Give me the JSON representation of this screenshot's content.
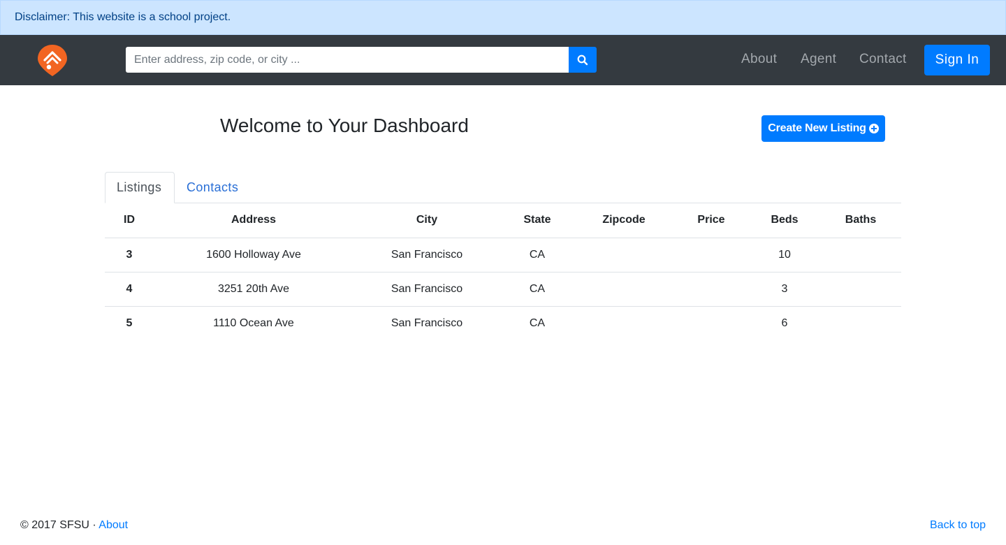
{
  "disclaimer": {
    "text": "Disclaimer: This website is a school project."
  },
  "navbar": {
    "logo_icon": "home-pin-logo-icon",
    "logo_color": "#f26522",
    "search": {
      "placeholder": "Enter address, zip code, or city ...",
      "value": "",
      "icon": "search-icon"
    },
    "links": {
      "about": "About",
      "agent": "Agent",
      "contact": "Contact"
    },
    "signin_label": "Sign In"
  },
  "dashboard": {
    "title": "Welcome to Your Dashboard",
    "create_label": "Create New Listing",
    "create_icon": "plus-circle-icon"
  },
  "tabs": {
    "listings": "Listings",
    "contacts": "Contacts",
    "active": "Listings"
  },
  "table": {
    "headers": {
      "id": "ID",
      "address": "Address",
      "city": "City",
      "state": "State",
      "zipcode": "Zipcode",
      "price": "Price",
      "beds": "Beds",
      "baths": "Baths"
    },
    "rows": [
      {
        "id": "3",
        "address": "1600 Holloway Ave",
        "city": "San Francisco",
        "state": "CA",
        "zipcode": "",
        "price": "",
        "beds": "10",
        "baths": ""
      },
      {
        "id": "4",
        "address": "3251 20th Ave",
        "city": "San Francisco",
        "state": "CA",
        "zipcode": "",
        "price": "",
        "beds": "3",
        "baths": ""
      },
      {
        "id": "5",
        "address": "1110 Ocean Ave",
        "city": "San Francisco",
        "state": "CA",
        "zipcode": "",
        "price": "",
        "beds": "6",
        "baths": ""
      }
    ]
  },
  "footer": {
    "copyright": "© 2017 SFSU · ",
    "about": "About",
    "back_to_top": "Back to top"
  },
  "colors": {
    "primary": "#007bff",
    "navbar": "#343a40",
    "alert_bg": "#cce5ff",
    "alert_text": "#004085"
  }
}
